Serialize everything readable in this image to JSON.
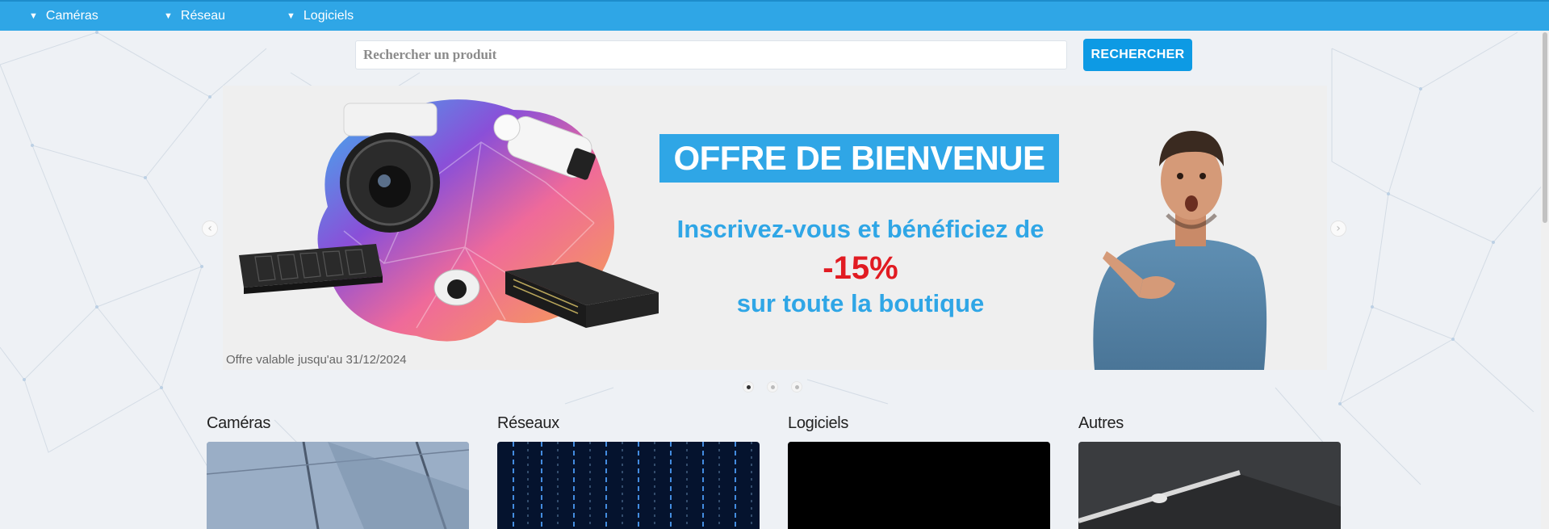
{
  "nav": {
    "items": [
      {
        "label": "Caméras"
      },
      {
        "label": "Réseau"
      },
      {
        "label": "Logiciels"
      }
    ]
  },
  "search": {
    "placeholder": "Rechercher un produit",
    "value": "",
    "button_label": "RECHERCHER"
  },
  "banner": {
    "title": "OFFRE DE BIENVENUE",
    "line1": "Inscrivez-vous et bénéficiez de",
    "discount": "-15%",
    "line2": "sur toute la boutique",
    "validity": "Offre valable jusqu'au 31/12/2024",
    "arrow_prev_icon": "chevron-left-icon",
    "arrow_next_icon": "chevron-right-icon",
    "slides_count": 3,
    "active_slide": 1
  },
  "categories": [
    {
      "label": "Caméras"
    },
    {
      "label": "Réseaux"
    },
    {
      "label": "Logiciels"
    },
    {
      "label": "Autres"
    }
  ],
  "colors": {
    "accent": "#2fa6e6",
    "button": "#0d9ae4",
    "discount": "#e11b22"
  }
}
